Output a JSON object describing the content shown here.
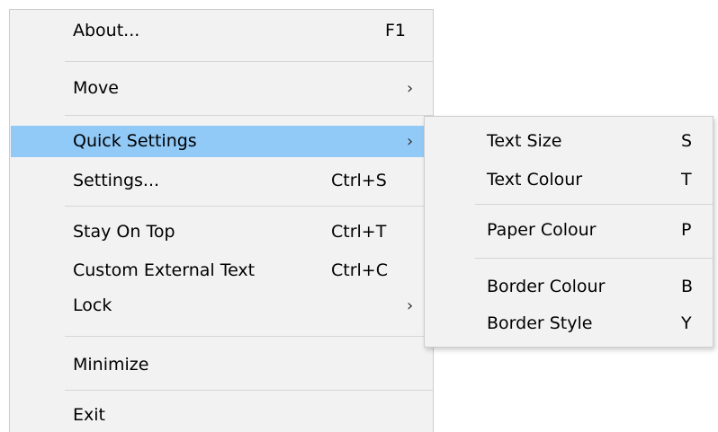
{
  "main_menu": {
    "items": [
      {
        "label": "About...",
        "shortcut": "F1"
      },
      {
        "label": "Move"
      },
      {
        "label": "Quick Settings"
      },
      {
        "label": "Settings...",
        "shortcut": "Ctrl+S"
      },
      {
        "label": "Stay On Top",
        "shortcut": "Ctrl+T"
      },
      {
        "label": "Custom External Text",
        "shortcut": "Ctrl+C"
      },
      {
        "label": "Lock"
      },
      {
        "label": "Minimize"
      },
      {
        "label": "Exit"
      }
    ],
    "submenu_glyph": "›"
  },
  "submenu": {
    "items": [
      {
        "label": "Text Size",
        "shortcut": "S"
      },
      {
        "label": "Text Colour",
        "shortcut": "T"
      },
      {
        "label": "Paper Colour",
        "shortcut": "P"
      },
      {
        "label": "Border Colour",
        "shortcut": "B"
      },
      {
        "label": "Border Style",
        "shortcut": "Y"
      }
    ]
  },
  "colors": {
    "menu_background": "#f2f2f2",
    "highlight": "#91c9f7",
    "separator": "#d6d6d6",
    "border": "#cccccc"
  },
  "icons": {
    "submenu_arrow": "chevron-right-icon"
  }
}
